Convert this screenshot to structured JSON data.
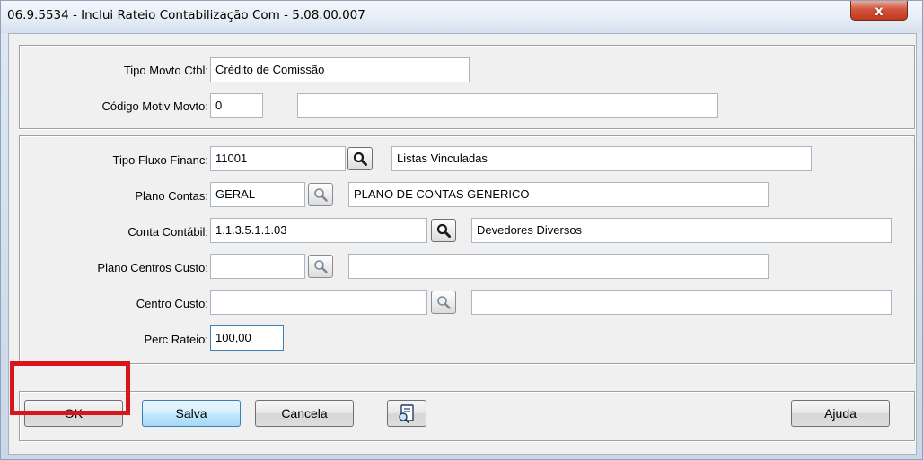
{
  "window": {
    "title": "06.9.5534 - Inclui Rateio Contabilização Com - 5.08.00.007",
    "close_label": "x"
  },
  "form": {
    "tipo_movto": {
      "label": "Tipo Movto Ctbl:",
      "value": "Crédito de Comissão"
    },
    "codigo_motiv": {
      "label": "Código Motiv Movto:",
      "value": "0",
      "desc": ""
    },
    "tipo_fluxo": {
      "label": "Tipo Fluxo Financ:",
      "value": "11001",
      "desc": "Listas Vinculadas"
    },
    "plano_contas": {
      "label": "Plano Contas:",
      "value": "GERAL",
      "desc": "PLANO DE CONTAS GENERICO"
    },
    "conta_contabil": {
      "label": "Conta Contábil:",
      "value": "1.1.3.5.1.1.03",
      "desc": "Devedores Diversos"
    },
    "plano_centros": {
      "label": "Plano Centros Custo:",
      "value": "",
      "desc": ""
    },
    "centro_custo": {
      "label": "Centro Custo:",
      "value": "",
      "desc": ""
    },
    "perc_rateio": {
      "label": "Perc Rateio:",
      "value": "100,00"
    }
  },
  "buttons": {
    "ok": "OK",
    "salva": "Salva",
    "cancela": "Cancela",
    "ajuda": "Ajuda"
  },
  "icons": {
    "zoom": "magnifier-icon",
    "notes": "notes-icon"
  },
  "colors": {
    "highlight": "#d9141b",
    "close": "#c1391f",
    "default_button": "#bee6fd"
  }
}
